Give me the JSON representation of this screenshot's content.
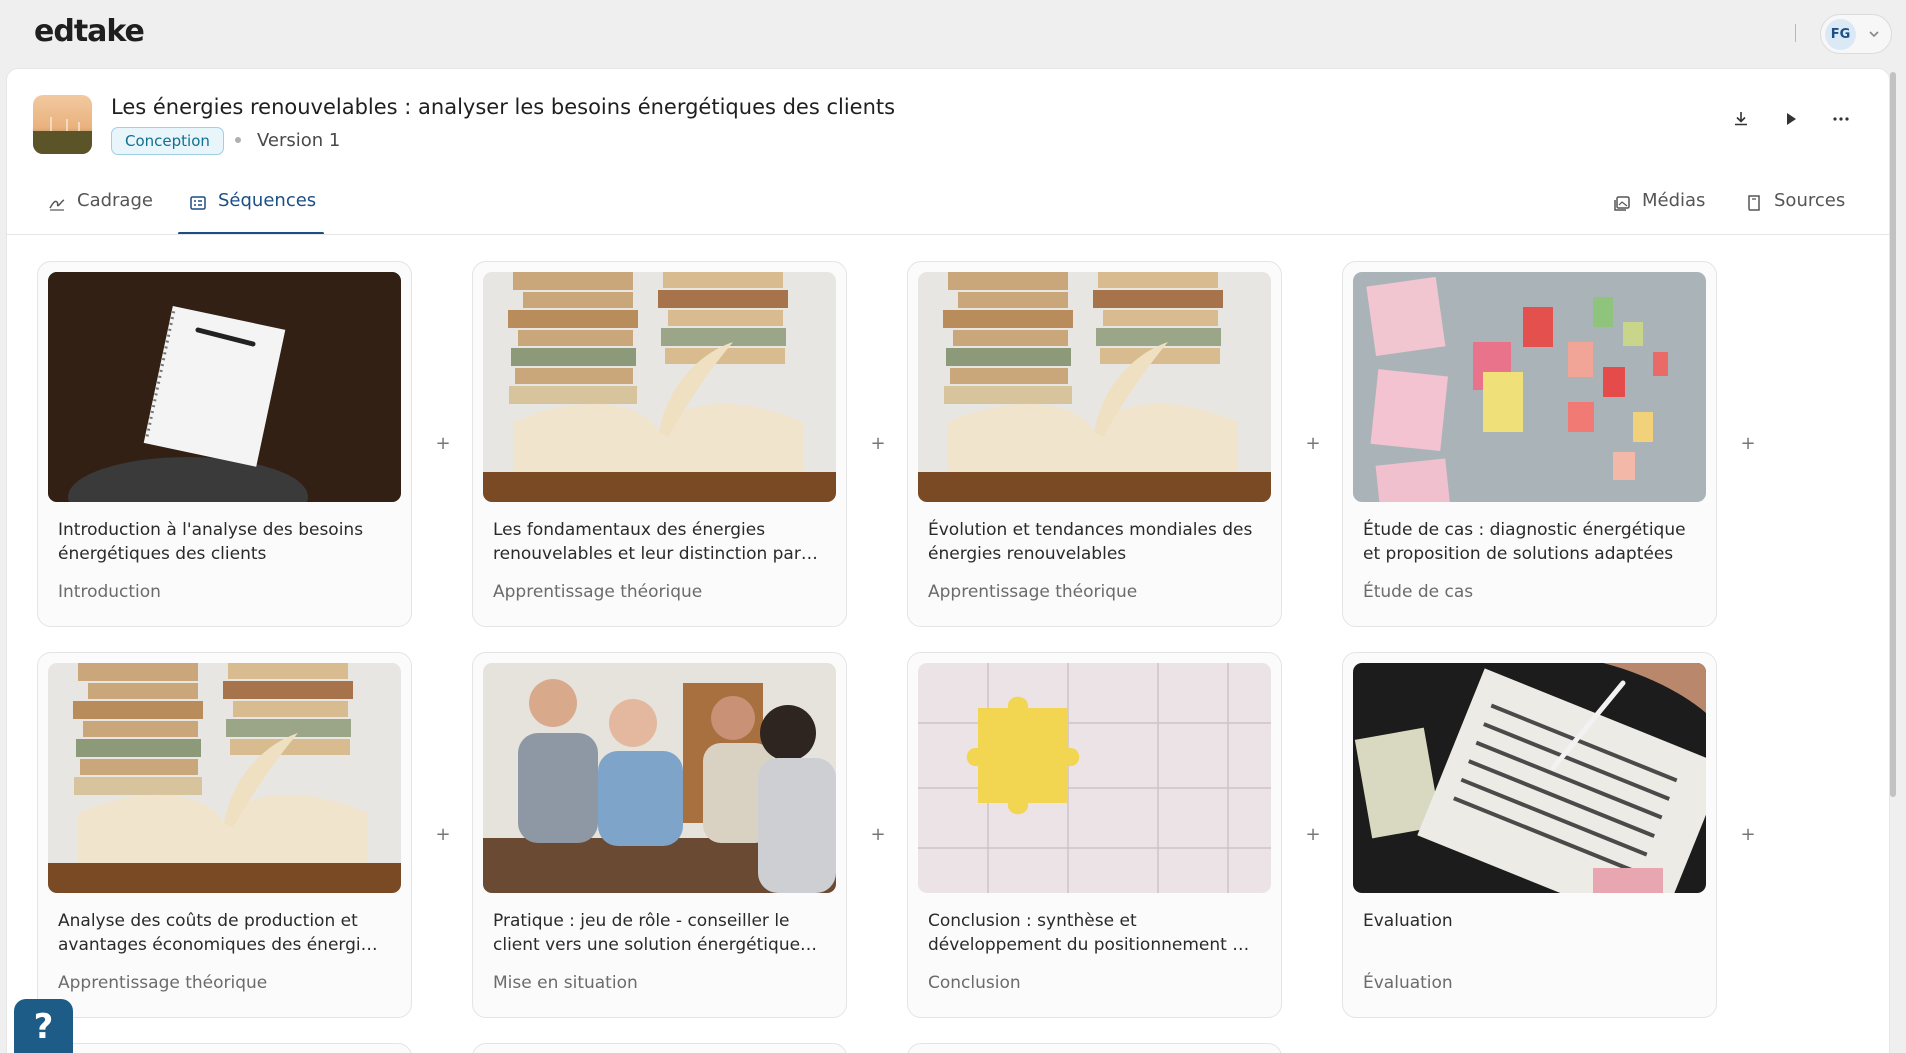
{
  "app": {
    "logo": "edtake"
  },
  "user": {
    "initials": "FG"
  },
  "header": {
    "title": "Les énergies renouvelables : analyser les besoins énergétiques des clients",
    "status_badge": "Conception",
    "version": "Version 1"
  },
  "tabs": [
    {
      "label": "Cadrage",
      "icon": "signature-icon",
      "active": false
    },
    {
      "label": "Séquences",
      "icon": "list-icon",
      "active": true
    },
    {
      "label": "Médias",
      "icon": "image-stack-icon",
      "active": false
    },
    {
      "label": "Sources",
      "icon": "book-icon",
      "active": false
    }
  ],
  "add_label": "+",
  "help_label": "?",
  "cards": [
    {
      "title": "Introduction à l'analyse des besoins énergétiques des clients",
      "type": "Introduction",
      "image": "notebook-photo"
    },
    {
      "title": "Les fondamentaux des énergies renouvelables et leur distinction par rapport aux énergies fossiles",
      "type": "Apprentissage théorique",
      "image": "open-book-photo"
    },
    {
      "title": "Évolution et tendances mondiales des énergies renouvelables",
      "type": "Apprentissage théorique",
      "image": "open-book-photo"
    },
    {
      "title": "Étude de cas : diagnostic énergétique et proposition de solutions adaptées",
      "type": "Étude de cas",
      "image": "sticky-notes-photo"
    },
    {
      "title": "Analyse des coûts de production et avantages économiques des énergies renouvelables",
      "type": "Apprentissage théorique",
      "image": "open-book-photo"
    },
    {
      "title": "Pratique : jeu de rôle - conseiller le client vers une solution énergétique adaptée",
      "type": "Mise en situation",
      "image": "group-discussion-photo"
    },
    {
      "title": "Conclusion : synthèse et développement du positionnement de conseiller",
      "type": "Conclusion",
      "image": "puzzle-photo"
    },
    {
      "title": "Evaluation",
      "type": "Évaluation",
      "image": "exam-sheet-photo"
    }
  ]
}
